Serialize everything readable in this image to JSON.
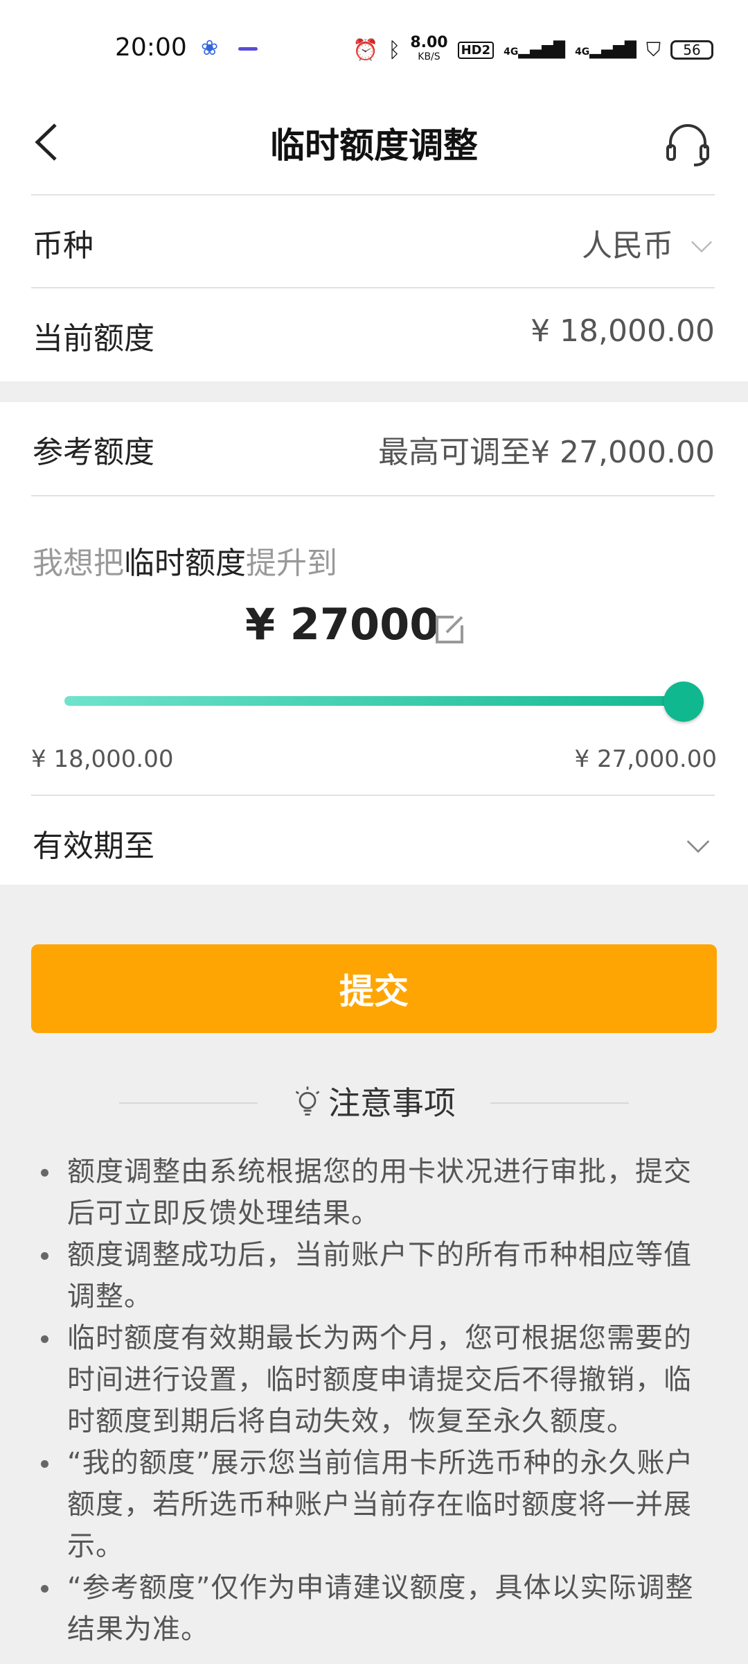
{
  "status": {
    "time": "20:00",
    "net_speed": "8.00",
    "net_unit": "KB/S",
    "hd": "HD2",
    "sig1": "4G",
    "sig2": "4G",
    "battery": "56"
  },
  "header": {
    "title": "临时额度调整"
  },
  "currency": {
    "label": "币种",
    "value": "人民币"
  },
  "current_limit": {
    "label": "当前额度",
    "value": "¥ 18,000.00"
  },
  "reference_limit": {
    "label": "参考额度",
    "value": "最高可调至¥ 27,000.00"
  },
  "raise": {
    "prefix": "我想把",
    "highlight": "临时额度",
    "suffix": "提升到",
    "amount": "¥ 27000",
    "min_label": "¥ 18,000.00",
    "max_label": "¥ 27,000.00",
    "slider_fraction": 1.0
  },
  "expiry": {
    "label": "有效期至"
  },
  "submit_label": "提交",
  "notes": {
    "title": "注意事项",
    "items": [
      "额度调整由系统根据您的用卡状况进行审批，提交后可立即反馈处理结果。",
      "额度调整成功后，当前账户下的所有币种相应等值调整。",
      "临时额度有效期最长为两个月，您可根据您需要的时间进行设置，临时额度申请提交后不得撤销，临时额度到期后将自动失效，恢复至永久额度。",
      "“我的额度”展示您当前信用卡所选币种的永久账户额度，若所选币种账户当前存在临时额度将一并展示。",
      "“参考额度”仅作为申请建议额度，具体以实际调整结果为准。"
    ]
  }
}
